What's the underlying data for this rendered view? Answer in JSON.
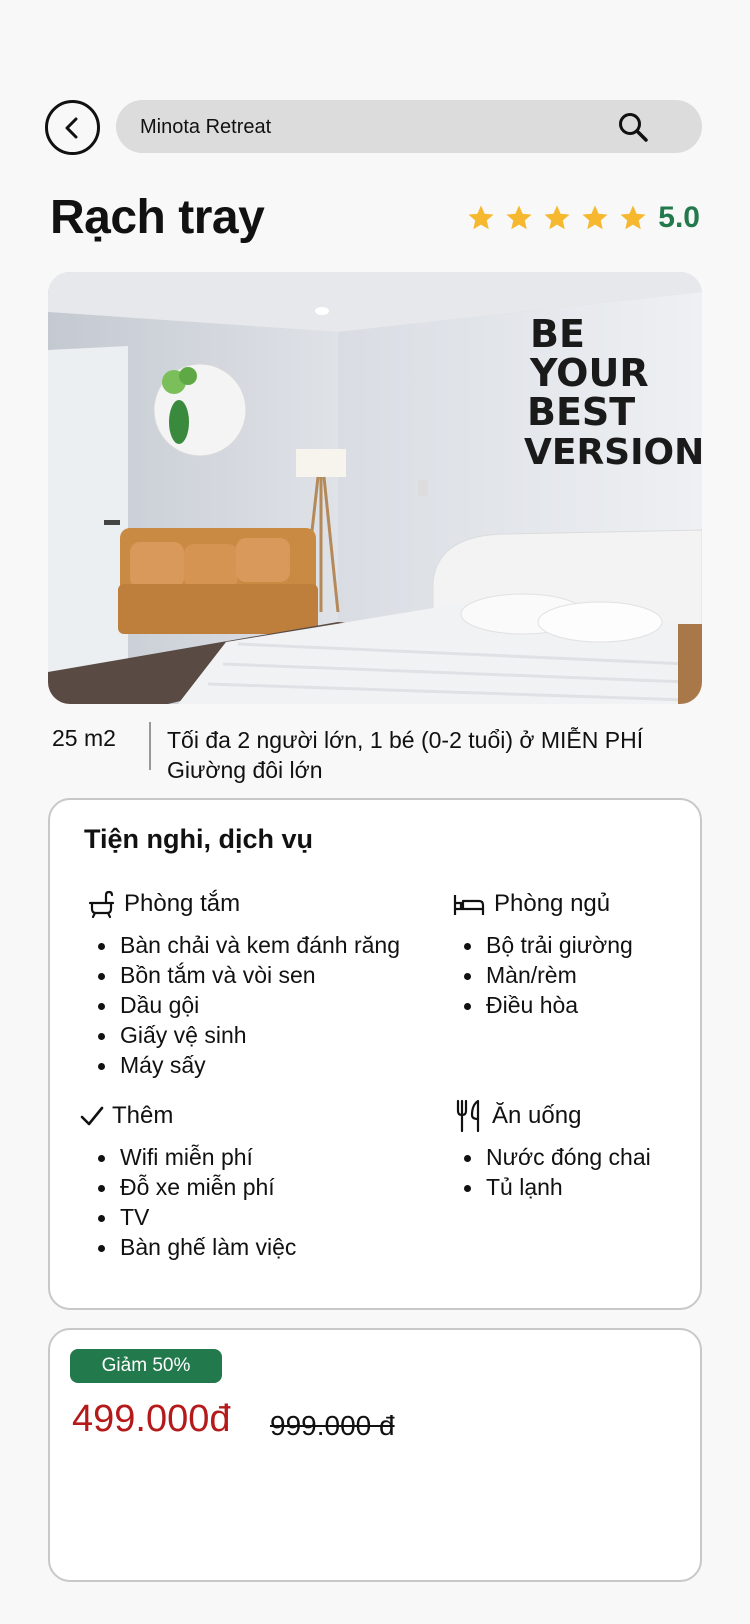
{
  "header": {
    "search_value": "Minota Retreat"
  },
  "room": {
    "title": "Rạch tray",
    "rating_value": "5.0",
    "stars": 5,
    "area": "25 m2",
    "capacity": "Tối đa 2 người lớn, 1 bé (0-2 tuổi) ở MIỄN PHÍ",
    "bed": "Giường đôi lớn",
    "photo_sign": [
      "BE",
      "YOUR",
      "BEST",
      "VERSION"
    ]
  },
  "amenities": {
    "title": "Tiện nghi, dịch vụ",
    "groups": [
      {
        "icon": "bathtub-icon",
        "label": "Phòng tắm",
        "items": [
          "Bàn chải và kem đánh răng",
          "Bồn tắm và vòi sen",
          "Dầu gội",
          "Giấy vệ sinh",
          "Máy sấy"
        ]
      },
      {
        "icon": "bed-icon",
        "label": "Phòng ngủ",
        "items": [
          "Bộ trải giường",
          "Màn/rèm",
          "Điều hòa"
        ]
      },
      {
        "icon": "checkmark-icon",
        "label": "Thêm",
        "items": [
          "Wifi miễn phí",
          "Đỗ xe miễn phí",
          "TV",
          "Bàn ghế làm việc"
        ]
      },
      {
        "icon": "fork-knife-icon",
        "label": "Ăn uống",
        "items": [
          "Nước đóng chai",
          "Tủ lạnh"
        ]
      }
    ]
  },
  "pricing": {
    "discount_label": "Giảm 50%",
    "price_now": "499.000đ",
    "price_old": "999.000 đ"
  },
  "colors": {
    "accent_green": "#227a4c",
    "star": "#f5b82e",
    "price_red": "#b51a1a"
  }
}
